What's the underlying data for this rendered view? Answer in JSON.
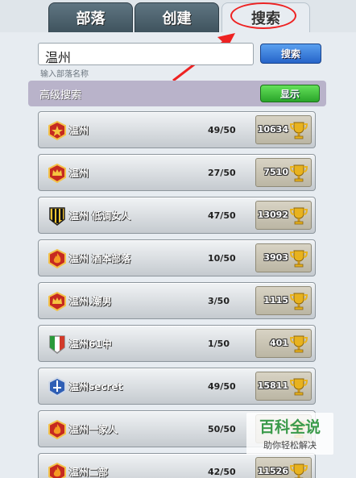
{
  "tabs": [
    {
      "label": "部落",
      "active": false
    },
    {
      "label": "创建",
      "active": false
    },
    {
      "label": "搜索",
      "active": true
    }
  ],
  "search": {
    "value": "温州",
    "hint": "输入部落名称",
    "button_label": "搜索"
  },
  "advanced": {
    "label": "高级搜索",
    "show_label": "显示"
  },
  "clans": [
    {
      "badge": "red-star-badge",
      "name": "温州",
      "members": "49/50",
      "trophies": "10634"
    },
    {
      "badge": "red-crown-badge",
      "name": "温州",
      "members": "27/50",
      "trophies": "7510"
    },
    {
      "badge": "black-yellow-stripe-badge",
      "name": "温州 低调女人",
      "members": "47/50",
      "trophies": "13092"
    },
    {
      "badge": "red-flame-badge",
      "name": "温州 酒本部落",
      "members": "10/50",
      "trophies": "3903"
    },
    {
      "badge": "red-crown-badge",
      "name": "温州.潮男",
      "members": "3/50",
      "trophies": "1115"
    },
    {
      "badge": "green-white-red-badge",
      "name": "温州61中",
      "members": "1/50",
      "trophies": "401"
    },
    {
      "badge": "blue-sword-badge",
      "name": "温州secret",
      "members": "49/50",
      "trophies": "15811"
    },
    {
      "badge": "red-flame-badge",
      "name": "温州一家人",
      "members": "50/50",
      "trophies": ""
    },
    {
      "badge": "red-flame-badge",
      "name": "温州二部",
      "members": "42/50",
      "trophies": "11526"
    }
  ],
  "watermark": {
    "title": "百科全说",
    "subtitle": "助你轻松解决"
  },
  "colors": {
    "accent_blue": "#2664c9",
    "accent_green": "#2aa52a",
    "highlight_red": "#e22222",
    "trophy_gold": "#e8b21e"
  }
}
